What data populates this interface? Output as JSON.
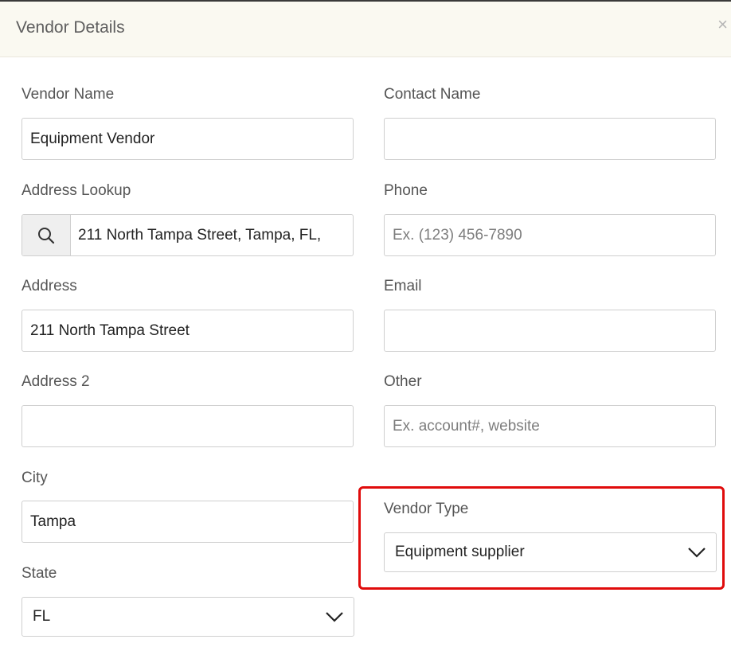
{
  "dialog": {
    "title": "Vendor Details",
    "close_symbol": "×"
  },
  "form": {
    "vendor_name": {
      "label": "Vendor Name",
      "value": "Equipment Vendor"
    },
    "contact_name": {
      "label": "Contact Name",
      "value": ""
    },
    "address_lookup": {
      "label": "Address Lookup",
      "value": "211 North Tampa Street, Tampa, FL,",
      "icon": "search-icon"
    },
    "phone": {
      "label": "Phone",
      "placeholder": "Ex. (123) 456-7890"
    },
    "address": {
      "label": "Address",
      "value": "211 North Tampa Street"
    },
    "email": {
      "label": "Email",
      "value": ""
    },
    "address2": {
      "label": "Address 2",
      "value": ""
    },
    "other": {
      "label": "Other",
      "placeholder": "Ex. account#, website"
    },
    "city": {
      "label": "City",
      "value": "Tampa"
    },
    "vendor_type": {
      "label": "Vendor Type",
      "value": "Equipment supplier"
    },
    "state": {
      "label": "State",
      "value": "FL"
    }
  },
  "colors": {
    "highlight_border": "#e00b0b",
    "header_background": "#faf9f1"
  }
}
